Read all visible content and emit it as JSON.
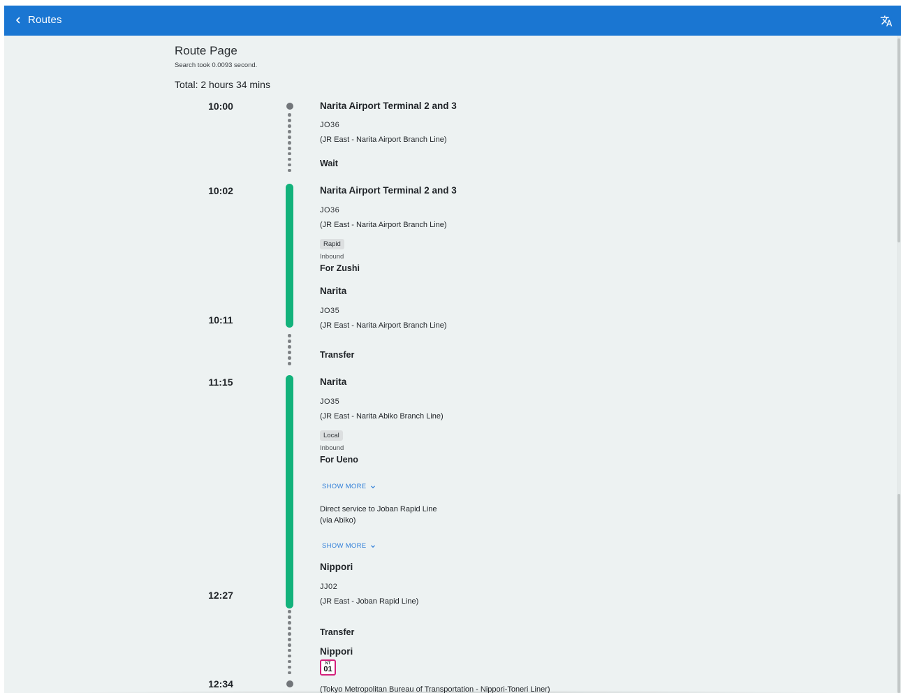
{
  "appbar": {
    "title": "Routes",
    "back_icon": "chevron-left-icon",
    "translate_icon": "translate-icon",
    "color": "#1a76d2"
  },
  "page": {
    "title": "Route Page",
    "search_took": "Search took 0.0093 second.",
    "total": "Total: 2 hours 34 mins"
  },
  "colors": {
    "rail_active": "#12b27b",
    "link": "#2f7ed8",
    "nippori_toneri_badge": "#d3207b"
  },
  "times": [
    "10:00",
    "10:02",
    "10:11",
    "11:15",
    "12:27",
    "12:34"
  ],
  "stops": [
    {
      "station": "Narita Airport Terminal 2 and 3",
      "code": "JO36",
      "line": "(JR East - Narita Airport Branch Line)"
    },
    {
      "station": "Narita Airport Terminal 2 and 3",
      "code": "JO36",
      "line": "(JR East - Narita Airport Branch Line)"
    },
    {
      "station": "Narita",
      "code": "JO35",
      "line": "(JR East - Narita Airport Branch Line)"
    },
    {
      "station": "Narita",
      "code": "JO35",
      "line": "(JR East - Narita Abiko Branch Line)"
    },
    {
      "station": "Nippori",
      "code": "JJ02",
      "line": "(JR East - Joban Rapid Line)"
    },
    {
      "station": "Nippori",
      "badge_top": "NT",
      "badge_num": "01",
      "line": "(Tokyo Metropolitan Bureau of Transportation - Nippori-Toneri Liner)"
    }
  ],
  "statuses": [
    "Wait",
    "Transfer",
    "Transfer"
  ],
  "segments": [
    {
      "type": "Rapid",
      "direction": "Inbound",
      "destination": "For Zushi"
    },
    {
      "type": "Local",
      "direction": "Inbound",
      "destination": "For Ueno",
      "show_more": "SHOW MORE",
      "note_lines": [
        "Direct service to Joban Rapid Line",
        "(via Abiko)"
      ],
      "show_more_2": "SHOW MORE"
    }
  ]
}
